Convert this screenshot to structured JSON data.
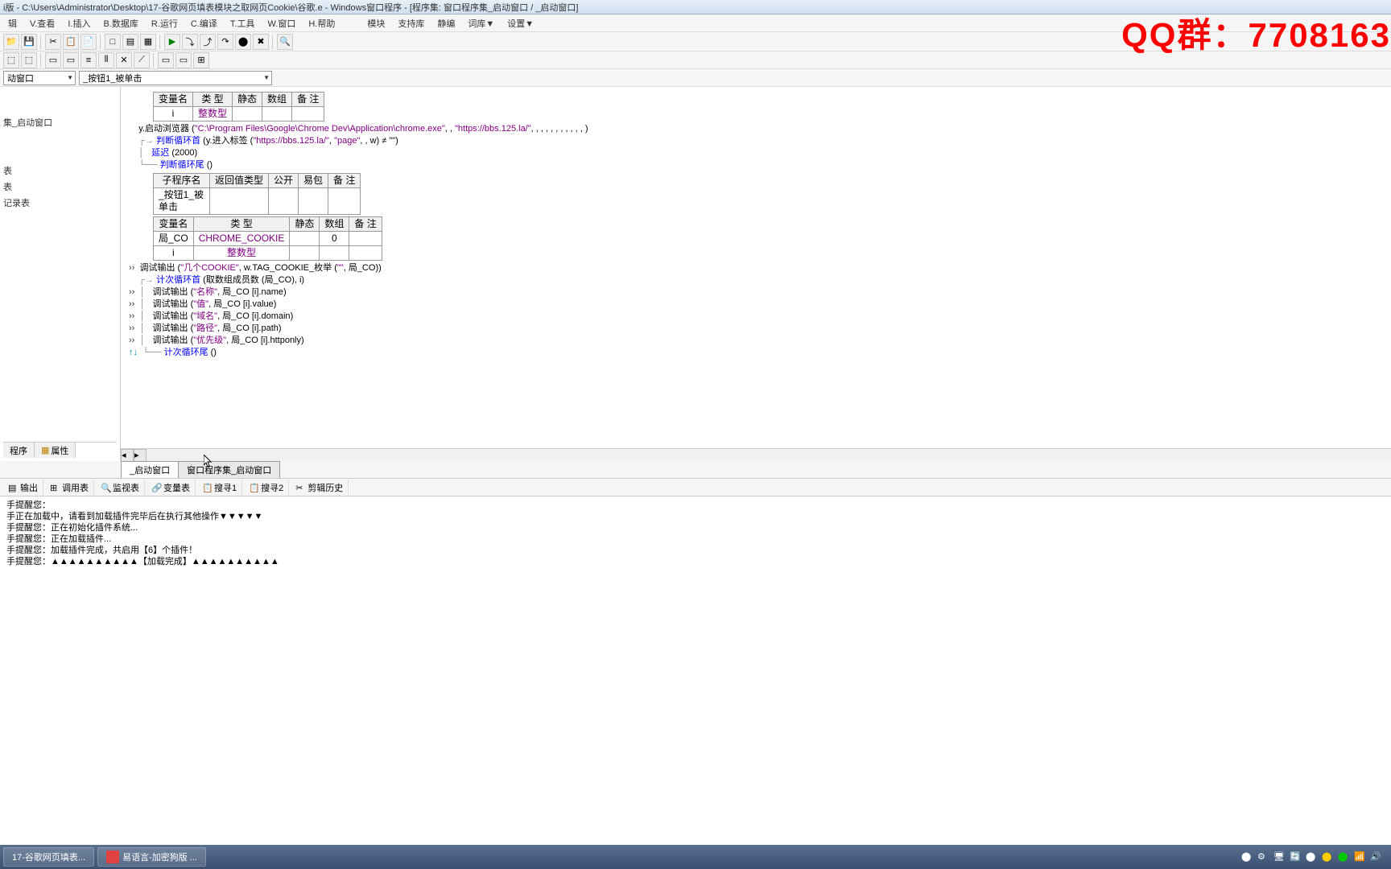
{
  "titlebar": "i版 - C:\\Users\\Administrator\\Desktop\\17-谷歌网页填表模块之取网页Cookie\\谷歌.e - Windows窗口程序 - [程序集: 窗口程序集_启动窗口 / _启动窗口]",
  "menu": {
    "m1": "辑",
    "m2": "V.查看",
    "m3": "I.插入",
    "m4": "B.数据库",
    "m5": "R.运行",
    "m6": "C.编译",
    "m7": "T.工具",
    "m8": "W.窗口",
    "m9": "H.帮助",
    "m10": "模块",
    "m11": "支持库",
    "m12": "静编",
    "m13": "词库▼",
    "m14": "设置▼"
  },
  "dropdowns": {
    "dd1": "动窗口",
    "dd2": "_按钮1_被单击"
  },
  "tree": {
    "t1": "集_启动窗口",
    "t2": "表",
    "t3": "表",
    "t4": "记录表"
  },
  "leftTabs": {
    "t1": "程序",
    "t2": "属性"
  },
  "varTable1": {
    "h1": "变量名",
    "h2": "类 型",
    "h3": "静态",
    "h4": "数组",
    "h5": "备 注",
    "r1c1": "i",
    "r1c2": "整数型"
  },
  "code": {
    "l1a": "y.启动浏览器",
    "l1b": "\"C:\\Program Files\\Google\\Chrome Dev\\Application\\chrome.exe\"",
    "l1c": "\"https://bbs.125.la/\"",
    "l2a": "判断循环首",
    "l2b": "y.进入标签",
    "l2c": "\"https://bbs.125.la/\"",
    "l2d": "\"page\"",
    "l2e": "≠ \"\"",
    "l3a": "延迟",
    "l3b": "2000",
    "l4a": "判断循环尾",
    "l5a": "调试输出",
    "l5b": "\"几个COOKIE\"",
    "l5c": "w.TAG_COOKIE_枚举",
    "l5d": "局_CO",
    "l6a": "计次循环首",
    "l6b": "取数组成员数",
    "l6c": "局_CO",
    "l6d": "i",
    "l7a": "调试输出",
    "l7b": "\"名称\"",
    "l7c": "局_CO [i].name",
    "l8a": "调试输出",
    "l8b": "\"值\"",
    "l8c": "局_CO [i].value",
    "l9a": "调试输出",
    "l9b": "\"域名\"",
    "l9c": "局_CO [i].domain",
    "l10a": "调试输出",
    "l10b": "\"路径\"",
    "l10c": "局_CO [i].path",
    "l11a": "调试输出",
    "l11b": "\"优先级\"",
    "l11c": "局_CO [i].httponly",
    "l12a": "计次循环尾"
  },
  "subTable": {
    "h1": "子程序名",
    "h2": "返回值类型",
    "h3": "公开",
    "h4": "易包",
    "h5": "备 注",
    "r1c1": "_按钮1_被单击"
  },
  "varTable2": {
    "h1": "变量名",
    "h2": "类 型",
    "h3": "静态",
    "h4": "数组",
    "h5": "备 注",
    "r1c1": "局_CO",
    "r1c2": "CHROME_COOKIE",
    "r1c4": "0",
    "r2c1": "i",
    "r2c2": "整数型"
  },
  "bottomTabs": {
    "t1": "_启动窗口",
    "t2": "窗口程序集_启动窗口"
  },
  "outputTabs": {
    "t1": "输出",
    "t2": "调用表",
    "t3": "监视表",
    "t4": "变量表",
    "t5": "搜寻1",
    "t6": "搜寻2",
    "t7": "剪辑历史"
  },
  "output": {
    "l1": "手提醒您：",
    "l2": "手正在加载中，请看到加载插件完毕后在执行其他操作▼▼▼▼▼",
    "l3": "手提醒您：正在初始化插件系统...",
    "l4": "手提醒您：正在加载插件...",
    "l5": "手提醒您：加载插件完成，共启用【6】个插件！",
    "l6": "手提醒您：▲▲▲▲▲▲▲▲▲▲【加载完成】▲▲▲▲▲▲▲▲▲▲"
  },
  "watermark": "QQ群：7708163",
  "taskbar": {
    "t1": "17-谷歌网页填表...",
    "t2": "易语言-加密狗版 ..."
  }
}
